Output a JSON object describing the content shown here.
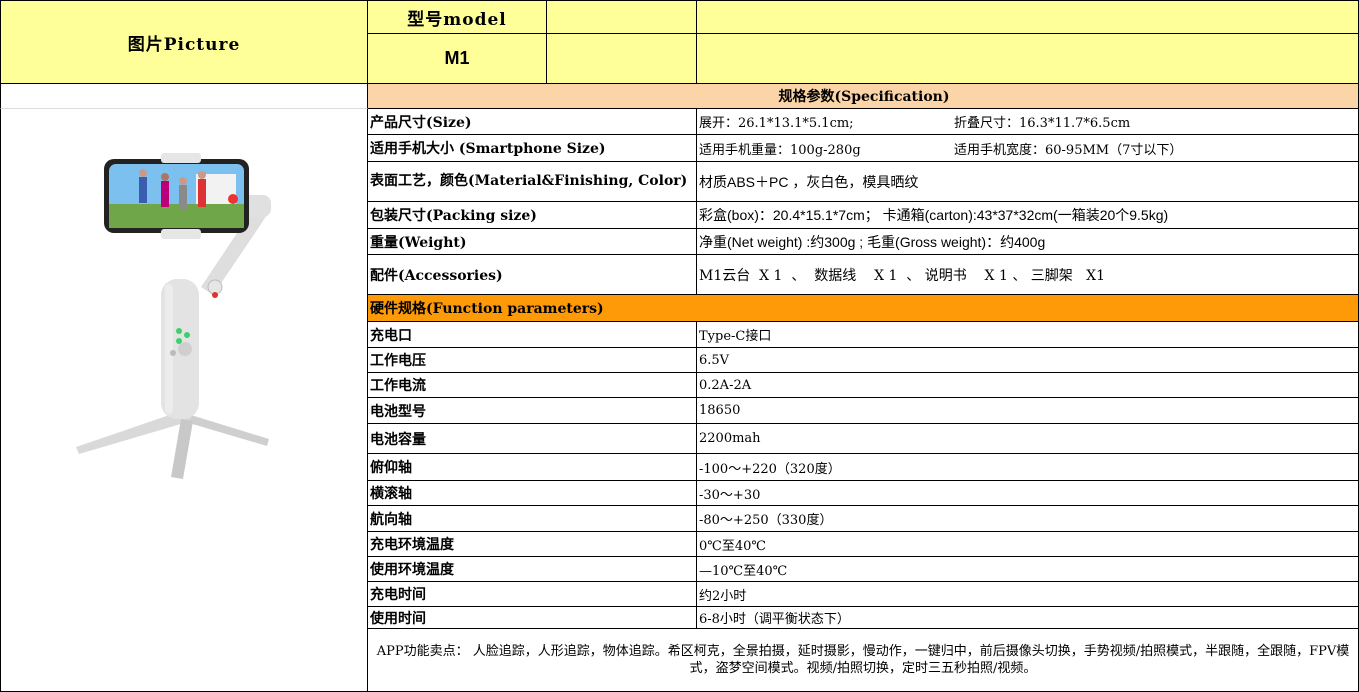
{
  "header": {
    "picture_label": "图片Picture",
    "model_label": "型号model",
    "model_value": "M1"
  },
  "spec_title": "规格参数(Specification)",
  "specs": [
    {
      "label": "产品尺寸(Size)",
      "value_a": "展开：26.1*13.1*5.1cm;",
      "value_b": "折叠尺寸：16.3*11.7*6.5cm"
    },
    {
      "label": "适用手机大小 (Smartphone Size)",
      "value_a": "适用手机重量：100g-280g",
      "value_b": "适用手机宽度：60-95MM（7寸以下）"
    },
    {
      "label": "表面工艺，颜色(Material&Finishing, Color)",
      "value": "材质ABS＋PC  ，灰白色，模具晒纹"
    },
    {
      "label": "包装尺寸(Packing size)",
      "value": "彩盒(box)：20.4*15.1*7cm； 卡通箱(carton):43*37*32cm(一箱装20个9.5kg)"
    },
    {
      "label": "重量(Weight)",
      "value": "净重(Net weight) :约300g ; 毛重(Gross weight)：约400g"
    },
    {
      "label": "配件(Accessories)",
      "value": "M1云台  X 1  、  数据线    X 1  、 说明书    X 1 、 三脚架   X1"
    }
  ],
  "function_title": "硬件规格(Function parameters)",
  "functions": [
    {
      "label": "充电口",
      "value": "Type-C接口"
    },
    {
      "label": "工作电压",
      "value": "6.5V"
    },
    {
      "label": "工作电流",
      "value": "0.2A-2A"
    },
    {
      "label": "电池型号",
      "value": "18650"
    },
    {
      "label": "电池容量",
      "value": "2200mah"
    },
    {
      "label": "俯仰轴",
      "value": "-100～+220（320度）"
    },
    {
      "label": "横滚轴",
      "value": "-30～+30"
    },
    {
      "label": "航向轴",
      "value": "-80～+250（330度）"
    },
    {
      "label": "充电环境温度",
      "value": "0℃至40℃"
    },
    {
      "label": "使用环境温度",
      "value": "—10℃至40℃"
    },
    {
      "label": "充电时间",
      "value": "约2小时"
    },
    {
      "label": "使用时间",
      "value": "6-8小时（调平衡状态下）"
    }
  ],
  "app_features": "APP功能卖点： 人脸追踪，人形追踪，物体追踪。希区柯克，全景拍摄，延时摄影，慢动作，一键归中，前后摄像头切换，手势视频/拍照模式，半跟随，全跟随，FPV模式，盗梦空间模式。视频/拍照切换，定时三五秒拍照/视频。",
  "colors": {
    "header_yellow": "#ffff99",
    "spec_title_bg": "#fbd4a8",
    "function_title_bg": "#fe9a07"
  }
}
